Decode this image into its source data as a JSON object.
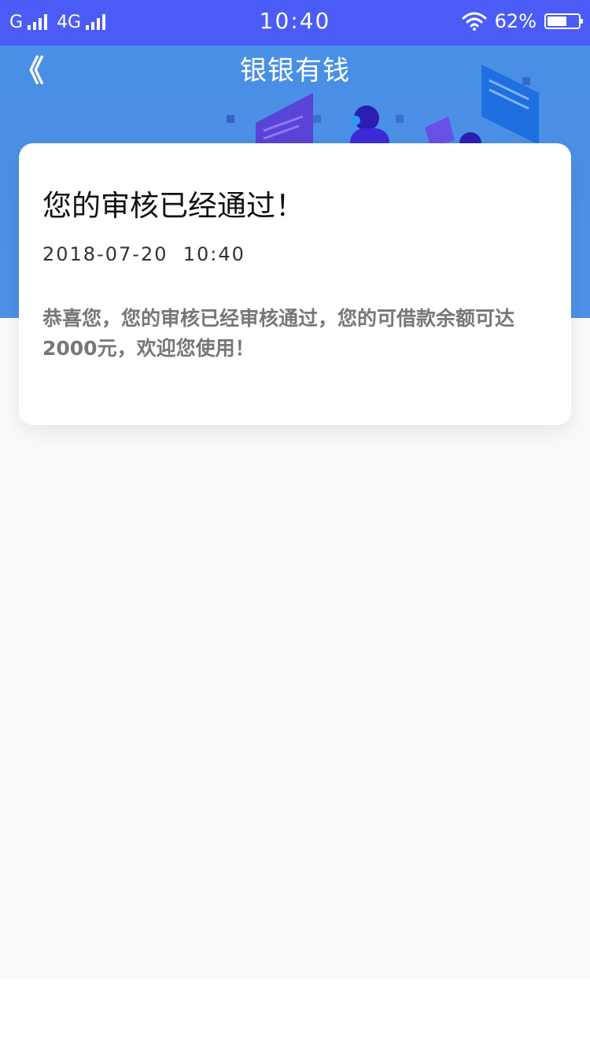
{
  "status_bar": {
    "carrier_1": "G",
    "carrier_2": "4G",
    "time": "10:40",
    "battery_percent": "62%",
    "battery_level": 0.62
  },
  "header": {
    "title": "银银有钱",
    "back_icon": "double-chevron-left-icon"
  },
  "notice": {
    "title": "您的审核已经通过！",
    "datetime": "2018-07-20  10:40",
    "body": "恭喜您，您的审核已经审核通过，您的可借款余额可达2000元，欢迎您使用！"
  },
  "colors": {
    "status_bar": "#4B5CF6",
    "header": "#4A8FE6",
    "page_bg": "#F9F9F9",
    "card_bg": "#FFFFFF"
  }
}
